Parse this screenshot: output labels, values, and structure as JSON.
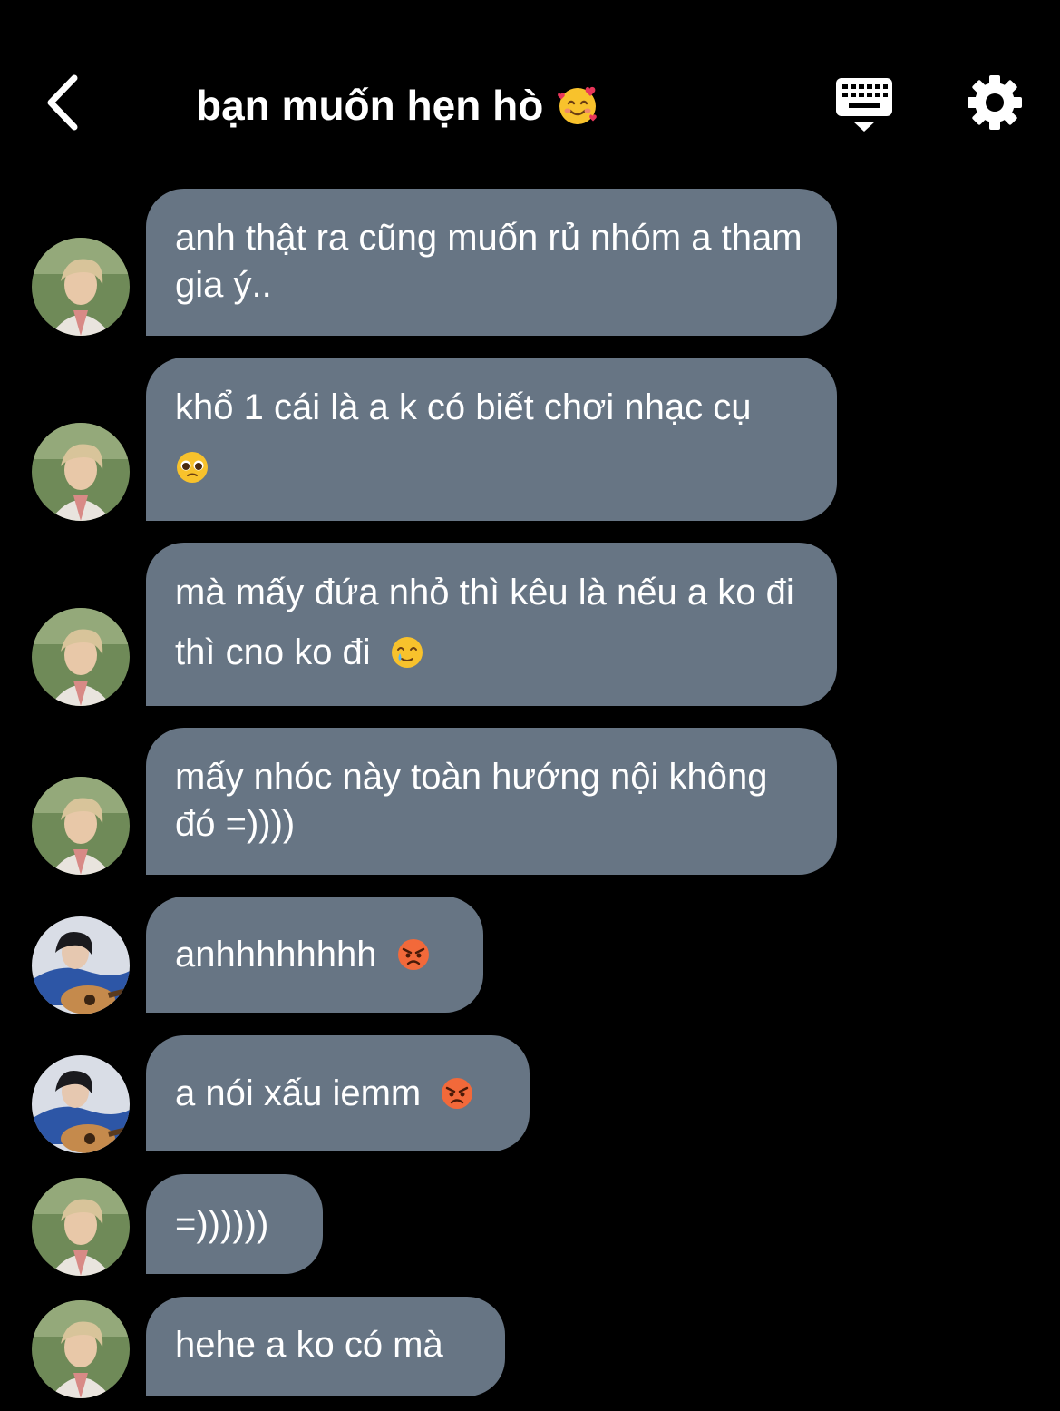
{
  "header": {
    "title": "bạn muốn hẹn hò",
    "title_emoji": "smiling-face-with-hearts-emoji",
    "back_icon": "chevron-left-icon",
    "keyboard_icon": "keyboard-hide-icon",
    "settings_icon": "gear-icon"
  },
  "colors": {
    "background": "#000000",
    "bubble": "#677584",
    "text": "#ffffff"
  },
  "messages": [
    {
      "sender": "blond-boy",
      "text": "anh thật ra cũng muốn rủ nhóm a tham gia ý..",
      "emoji": ""
    },
    {
      "sender": "blond-boy",
      "text": "khổ 1 cái là a k có biết chơi nhạc cụ",
      "emoji": "pleading-face-emoji"
    },
    {
      "sender": "blond-boy",
      "text": "mà mấy đứa nhỏ thì kêu là nếu a ko đi thì cno ko đi",
      "emoji": "smiling-face-with-tear-emoji"
    },
    {
      "sender": "blond-boy",
      "text": "mấy nhóc này toàn hướng nội không đó =))))",
      "emoji": ""
    },
    {
      "sender": "guitar-boy",
      "text": "anhhhhhhhh",
      "emoji": "angry-face-emoji"
    },
    {
      "sender": "guitar-boy",
      "text": "a nói xấu iemm",
      "emoji": "angry-face-emoji"
    },
    {
      "sender": "blond-boy",
      "text": "=))))))",
      "emoji": ""
    },
    {
      "sender": "blond-boy",
      "text": "hehe a ko có mà",
      "emoji": ""
    }
  ]
}
